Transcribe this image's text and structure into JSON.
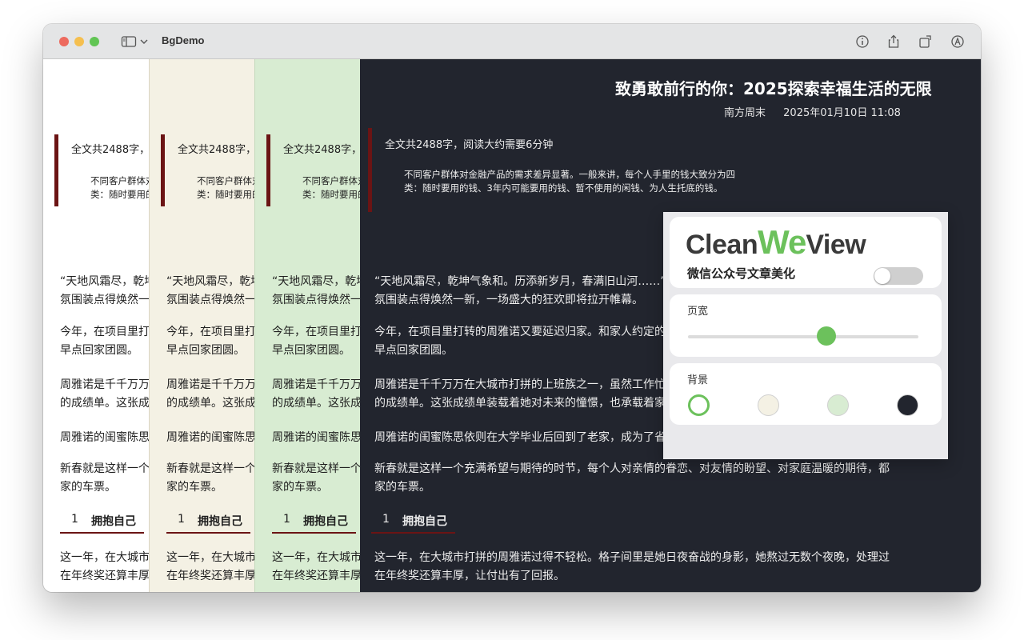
{
  "window": {
    "title": "BgDemo",
    "traffic_lights": {
      "close": "#ed6a5e",
      "minimize": "#f5bf4f",
      "zoom": "#61c554"
    }
  },
  "toolbar_icons": [
    "sidebar-icon",
    "chevron-down-icon",
    "info-icon",
    "share-icon",
    "rotate-icon",
    "markup-icon"
  ],
  "article": {
    "title": "致勇敢前行的你：2025探索幸福生活的无限",
    "source": "南方周末",
    "date": "2025年01月10日 11:08",
    "summary_title": "全文共2488字，阅读大约需要6分钟",
    "summary_line1": "不同客户群体对金融产品的需求差异显著。一般来讲，每个人手里的钱大致分为四",
    "summary_line2": "类：随时要用的钱、3年内可能要用的钱、暂不使用的闲钱、为人生托底的钱。",
    "paragraphs": [
      [
        "“天地风霜尽，乾坤气象和。历添新岁月，春满旧山河……”随着新春临近，从乡村到城市，水城到处",
        "氛围装点得焕然一新，一场盛大的狂欢即将拉开帷幕。"
      ],
      [
        "今年，在项目里打转的周雅诺又要延迟归家。和家人约定的“春节团圆”，成了一句“等我消息”，",
        "早点回家团圆。"
      ],
      [
        "周雅诺是千千万万在大城市打拼的上班族之一，虽然工作忙碌，但她今年终于拿到了期待的年终奖。",
        "的成绩单。这张成绩单装载着她对未来的憧憬，也承载着家人的期待。"
      ],
      [
        "周雅诺的闺蜜陈思依则在大学毕业后回到了老家，成为了省会城市的一名基层公务人员。临近新年，两姐妹"
      ],
      [
        "新春就是这样一个充满希望与期待的时节，每个人对亲情的眷恋、对友情的盼望、对家庭温暖的期待，都",
        "家的车票。"
      ]
    ],
    "section_number": "1",
    "section_title": "拥抱自己",
    "after_section": [
      "这一年，在大城市打拼的周雅诺过得不轻松。格子间里是她日夜奋战的身影，她熬过无数个夜晚，处理过",
      "在年终奖还算丰厚，让付出有了回报。"
    ]
  },
  "panels": [
    {
      "name": "white",
      "bg": "#ffffff"
    },
    {
      "name": "beige",
      "bg": "#f4f1e4"
    },
    {
      "name": "green",
      "bg": "#d8ecd2"
    },
    {
      "name": "dark",
      "bg": "#22252e"
    }
  ],
  "popover": {
    "logo_clean": "Clean",
    "logo_we": "We",
    "logo_view": "View",
    "toggle_label": "微信公众号文章美化",
    "toggle_on": false,
    "width_label": "页宽",
    "width_value": 0.6,
    "background_label": "背景",
    "swatches": [
      {
        "name": "white",
        "color": "#ffffff",
        "selected": true
      },
      {
        "name": "beige",
        "color": "#f4f1e4",
        "selected": false
      },
      {
        "name": "green",
        "color": "#d8ecd2",
        "selected": false
      },
      {
        "name": "dark",
        "color": "#22252e",
        "selected": false
      }
    ],
    "accent": "#6cc15c"
  }
}
